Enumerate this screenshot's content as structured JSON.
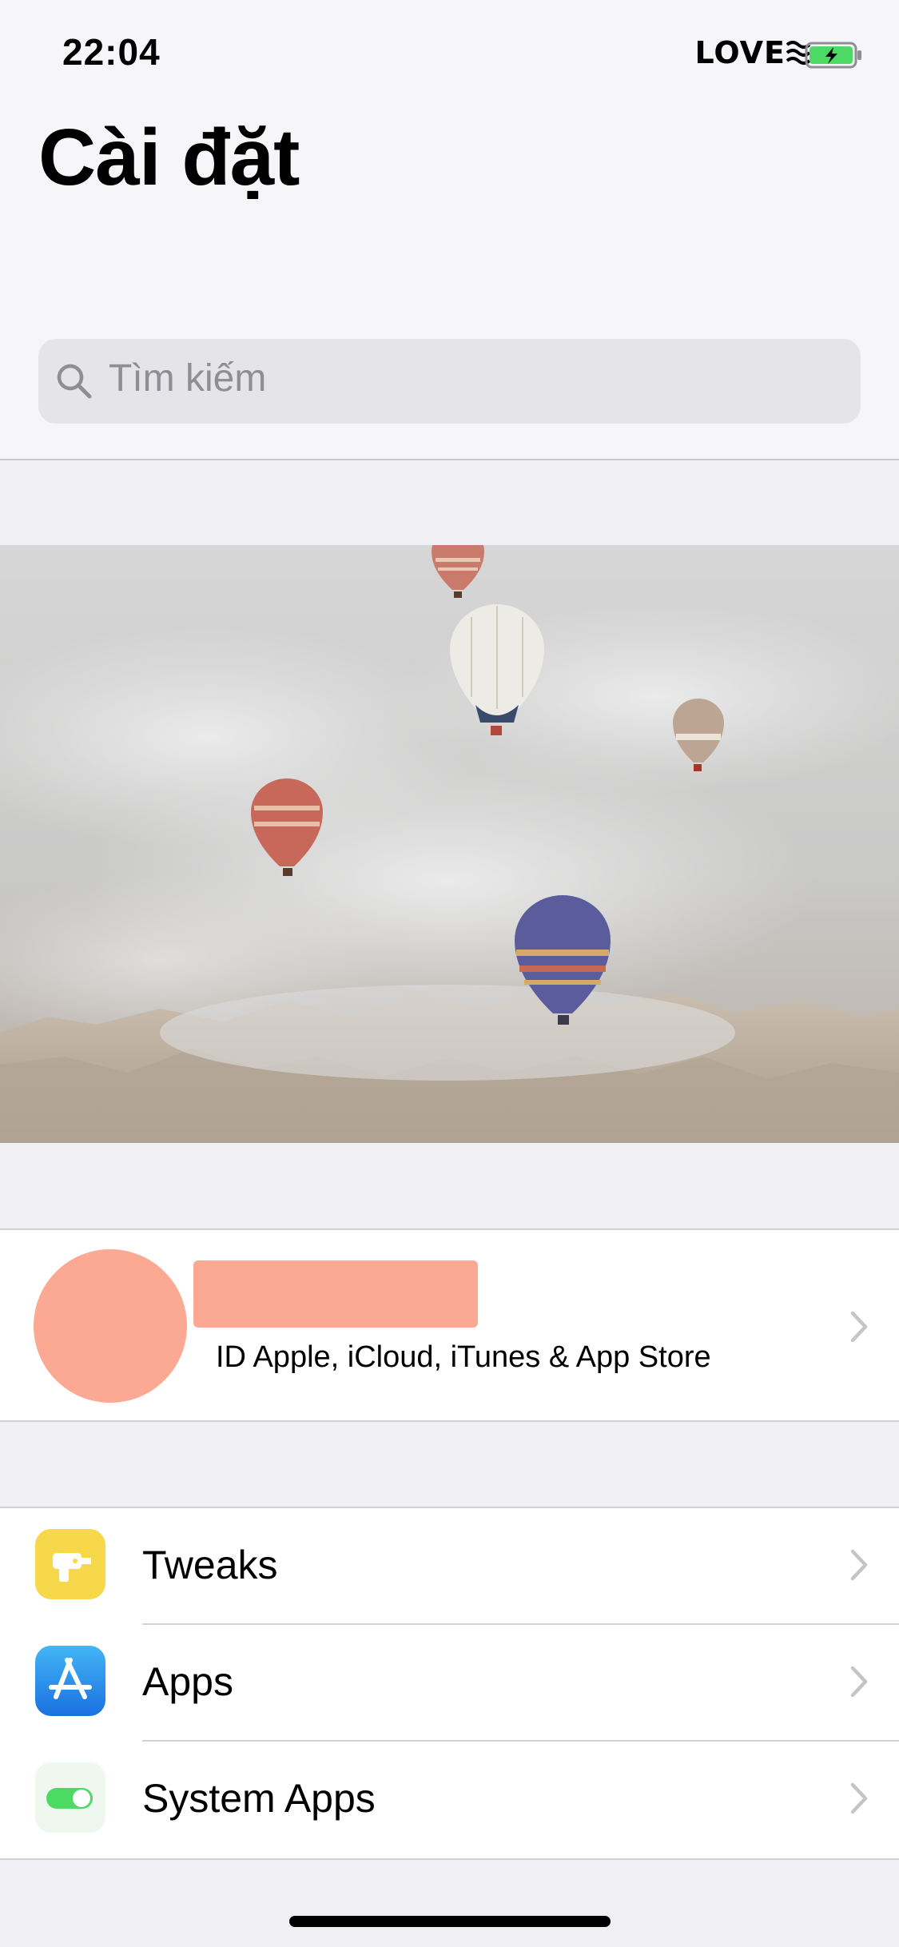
{
  "status_bar": {
    "time": "22:04",
    "carrier": "LOVE",
    "wifi_icon": "wifi-waves-icon",
    "battery_icon": "battery-charging-icon",
    "battery_color": "#4cd964"
  },
  "header": {
    "title": "Cài đặt",
    "search_placeholder": "Tìm kiếm"
  },
  "banner": {
    "image": "hot-air-balloons-over-clouds"
  },
  "profile": {
    "subtitle": "ID Apple, iCloud, iTunes & App Store",
    "avatar_color": "#fca993"
  },
  "list": {
    "items": [
      {
        "label": "Tweaks",
        "icon": "drill-icon",
        "icon_bg": "#f7d84a"
      },
      {
        "label": "Apps",
        "icon": "app-store-icon",
        "icon_bg": "#2f8cf0"
      },
      {
        "label": "System Apps",
        "icon": "toggle-switch-icon",
        "icon_bg": "#eef8ee"
      }
    ]
  },
  "colors": {
    "background": "#efeff4",
    "separator": "#d1d1d6",
    "secondary_text": "#8e8e93"
  }
}
